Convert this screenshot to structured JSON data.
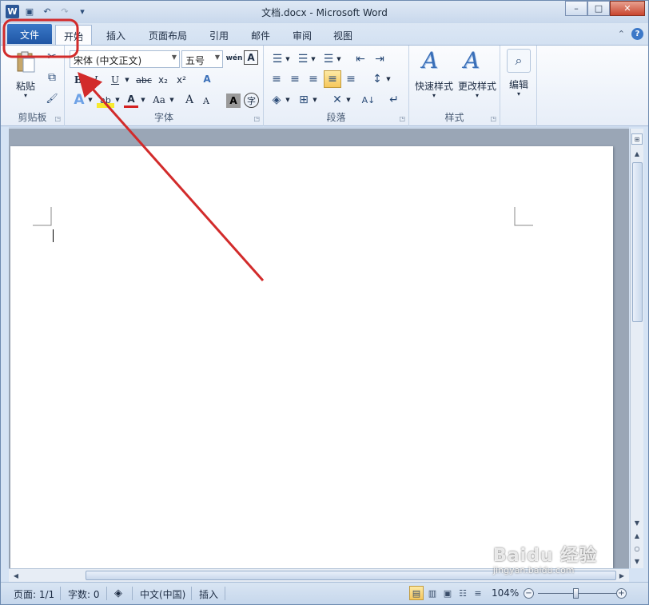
{
  "window": {
    "title": "文档.docx - Microsoft Word",
    "controls": {
      "minimize": "–",
      "maximize": "□",
      "close": "✕"
    }
  },
  "qat": {
    "logo": "W",
    "save": "▣",
    "undo": "↶",
    "redo": "↷",
    "customize": "▾"
  },
  "tabs": [
    {
      "label": "文件"
    },
    {
      "label": "开始"
    },
    {
      "label": "插入"
    },
    {
      "label": "页面布局"
    },
    {
      "label": "引用"
    },
    {
      "label": "邮件"
    },
    {
      "label": "审阅"
    },
    {
      "label": "视图"
    }
  ],
  "tab_right": {
    "minimize_ribbon": "⌃",
    "help": "?"
  },
  "ribbon": {
    "clipboard": {
      "label": "剪贴板",
      "paste": "粘贴",
      "cut_icon": "✂",
      "copy_icon": "⧉",
      "painter_icon": "🖌"
    },
    "font": {
      "label": "字体",
      "font_name": "宋体 (中文正文)",
      "font_size": "五号",
      "phonetic": "wén",
      "border_char": "A",
      "bold": "B",
      "italic": "I",
      "underline": "U",
      "strike": "abc",
      "subscript": "x₂",
      "superscript": "x²",
      "clear": "A",
      "text_effect": "A",
      "highlight": "ab",
      "font_color": "A",
      "change_case": "Aa",
      "grow": "A",
      "shrink": "A",
      "char_shading": "A",
      "enclose": "字"
    },
    "paragraph": {
      "label": "段落",
      "bullets": "☰",
      "numbering": "☰",
      "multilevel": "☰",
      "decrease_indent": "⇤",
      "increase_indent": "⇥",
      "align_left": "≡",
      "center": "≡",
      "align_right": "≡",
      "justify": "≡",
      "distribute": "≡",
      "line_spacing": "↕",
      "shading": "◈",
      "borders": "⊞",
      "chinese_layout": "✕",
      "sort": "A↓",
      "show_marks": "↵"
    },
    "styles": {
      "label": "样式",
      "quick_styles": "快速样式",
      "change_styles": "更改样式",
      "icon_letter": "A"
    },
    "editing": {
      "label": "编辑",
      "icon": "⌕"
    }
  },
  "statusbar": {
    "page": "页面: 1/1",
    "words": "字数: 0",
    "language": "中文(中国)",
    "insert_mode": "插入",
    "zoom": "104%",
    "zoom_minus": "−",
    "zoom_plus": "+"
  },
  "watermark": {
    "main": "Baidu 经验",
    "sub": "jingyan.baidu.com"
  },
  "annotation_color": "#d22b2b"
}
